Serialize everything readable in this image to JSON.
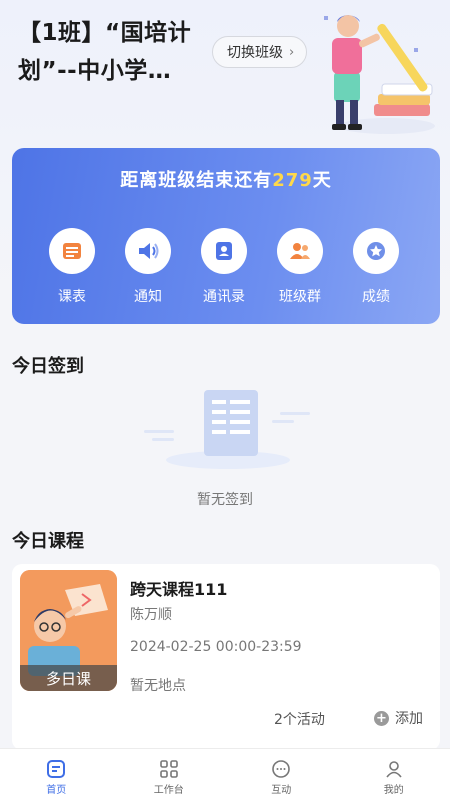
{
  "header": {
    "class_title": "【1班】“国培计划”--中小学…",
    "switch_label": "切换班级"
  },
  "banner": {
    "countdown_prefix": "距离班级结束还有",
    "countdown_days": "279",
    "countdown_suffix": "天",
    "menu": [
      {
        "label": "课表",
        "icon": "schedule-icon"
      },
      {
        "label": "通知",
        "icon": "speaker-icon"
      },
      {
        "label": "通讯录",
        "icon": "contacts-icon"
      },
      {
        "label": "班级群",
        "icon": "group-icon"
      },
      {
        "label": "成绩",
        "icon": "star-badge-icon"
      }
    ]
  },
  "checkin": {
    "title": "今日签到",
    "empty_text": "暂无签到"
  },
  "courses": {
    "title": "今日课程",
    "items": [
      {
        "tag": "多日课",
        "name": "跨天课程111",
        "teacher": "陈万顺",
        "time": "2024-02-25 00:00-23:59",
        "place": "暂无地点",
        "activity_count": "2个活动",
        "add_label": "添加"
      }
    ]
  },
  "nav": [
    {
      "label": "首页",
      "icon": "home-icon",
      "active": true
    },
    {
      "label": "工作台",
      "icon": "grid-icon",
      "active": false
    },
    {
      "label": "互动",
      "icon": "chat-icon",
      "active": false
    },
    {
      "label": "我的",
      "icon": "user-icon",
      "active": false
    }
  ],
  "colors": {
    "accent": "#3f6ee6",
    "banner_start": "#4e74e6",
    "banner_end": "#8ba7f4",
    "highlight": "#ffd84a"
  }
}
